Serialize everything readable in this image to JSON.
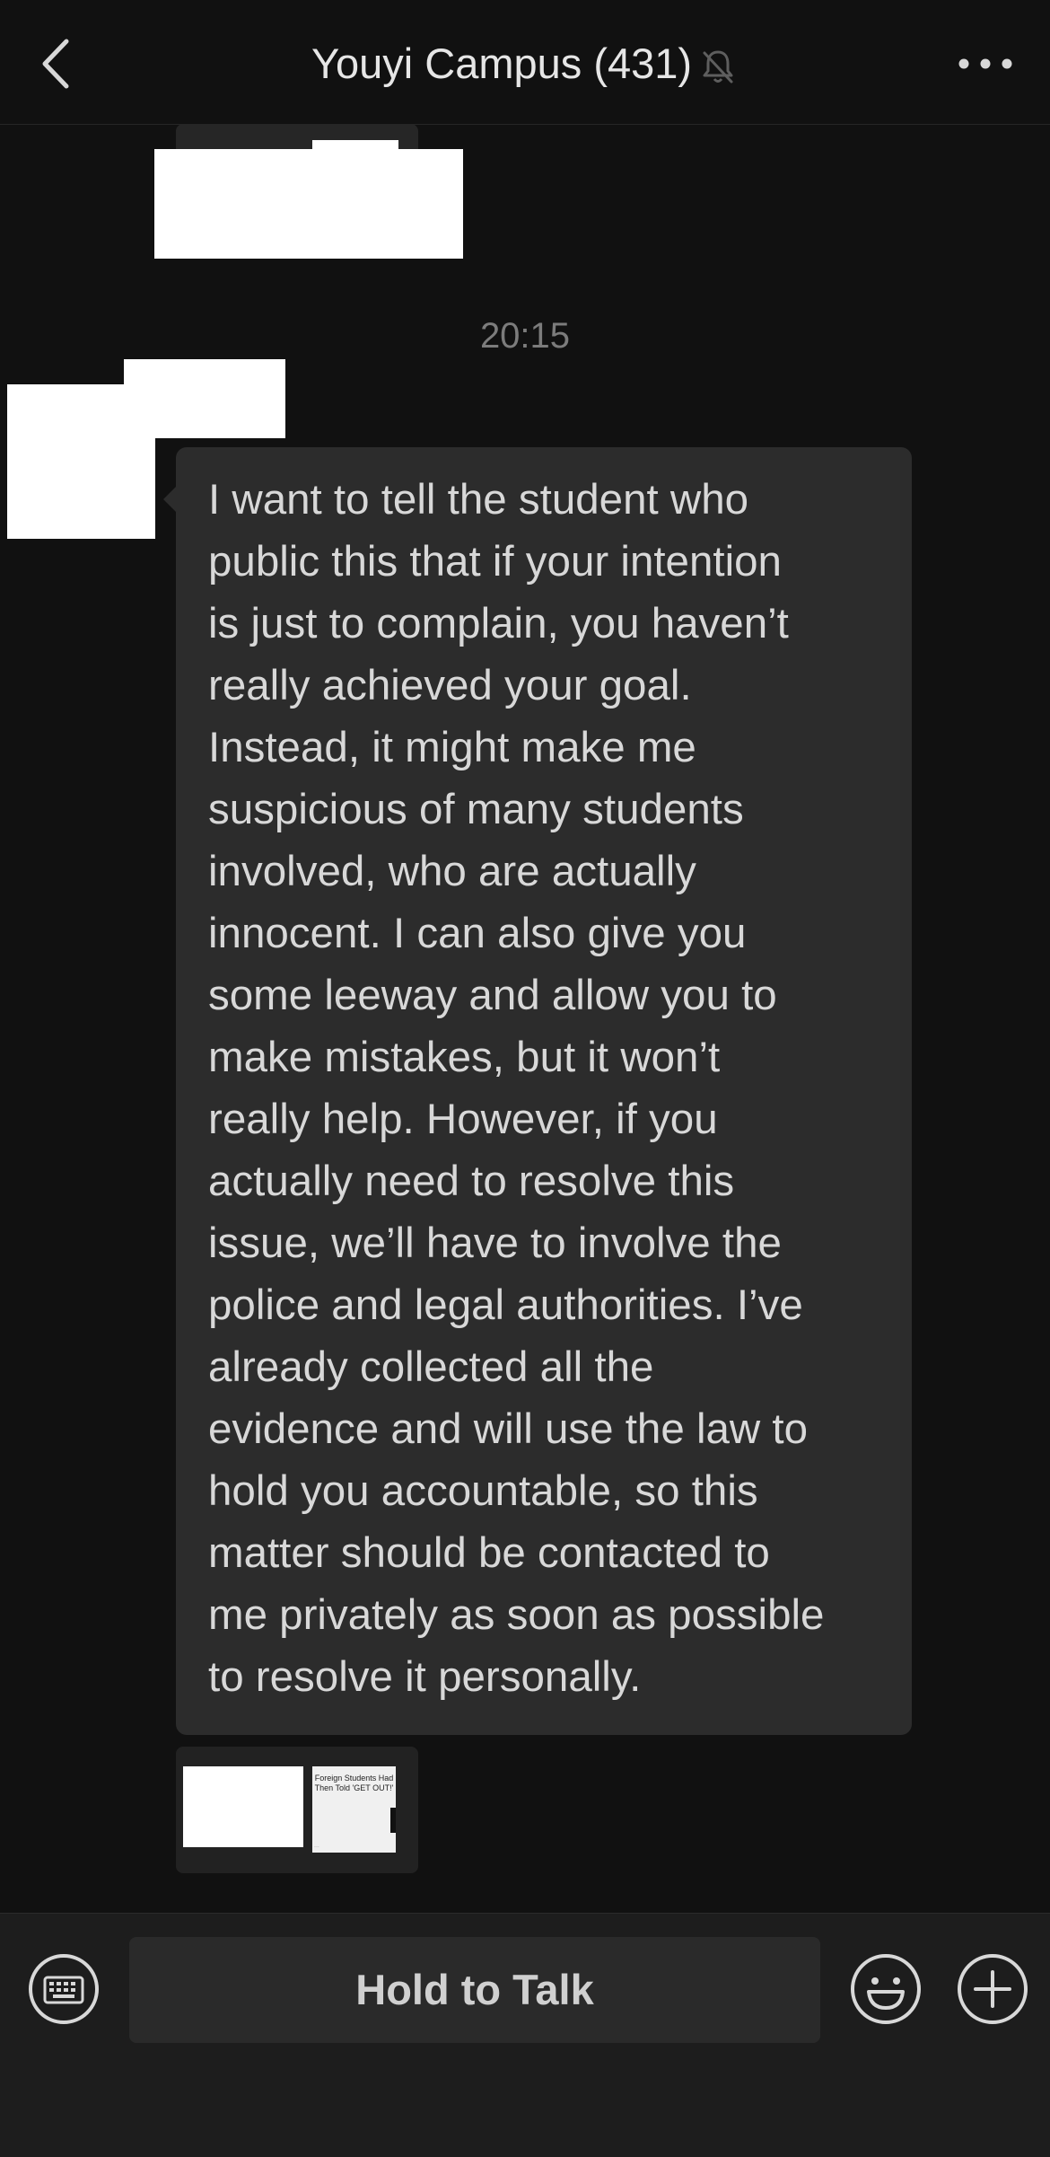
{
  "header": {
    "title": "Youyi Campus (431)",
    "back_icon": "chevron-left-icon",
    "mute_icon": "bell-slash-icon",
    "more_icon": "more-dots-icon"
  },
  "chat": {
    "timestamp": "20:15",
    "message": "I want to tell the student who\npublic this that if your intention\nis just to complain, you haven’t\nreally achieved your goal.\nInstead, it might make me\nsuspicious of many students\ninvolved, who are actually\ninnocent. I can also give you\nsome leeway and allow you to\nmake mistakes, but it won’t\nreally help. However, if you\nactually need to resolve this\nissue, we’ll have to involve the\npolice and legal authorities. I’ve\nalready collected all the\nevidence and will use the law to\nhold you accountable, so this\nmatter should be contacted to\nme privately as soon as possible\nto resolve it personally.",
    "preview": {
      "headline": "Foreign Students Had Then Told 'GET OUT!'",
      "source": "..."
    }
  },
  "input_bar": {
    "hold_to_talk": "Hold to Talk",
    "keyboard_icon": "keyboard-icon",
    "emoji_icon": "emoji-icon",
    "plus_icon": "plus-icon"
  }
}
